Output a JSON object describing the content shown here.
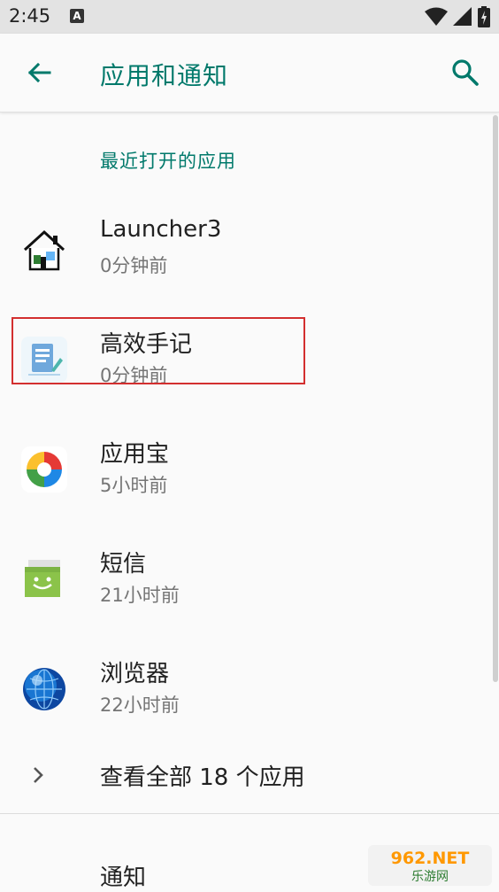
{
  "status_bar": {
    "time": "2:45",
    "notification_icon": "A"
  },
  "app_bar": {
    "title": "应用和通知"
  },
  "recent": {
    "header": "最近打开的应用",
    "apps": [
      {
        "name": "Launcher3",
        "time": "0分钟前",
        "icon": "launcher-house-icon"
      },
      {
        "name": "高效手记",
        "time": "0分钟前",
        "icon": "notes-app-icon"
      },
      {
        "name": "应用宝",
        "time": "5小时前",
        "icon": "app-store-icon"
      },
      {
        "name": "短信",
        "time": "21小时前",
        "icon": "messages-icon"
      },
      {
        "name": "浏览器",
        "time": "22小时前",
        "icon": "browser-globe-icon"
      }
    ]
  },
  "see_all": {
    "label": "查看全部 18 个应用"
  },
  "notifications": {
    "label": "通知"
  },
  "watermark": {
    "top": "962.NET",
    "bottom": "乐游网"
  },
  "colors": {
    "accent": "#00796b",
    "highlight": "#d32f2f"
  }
}
